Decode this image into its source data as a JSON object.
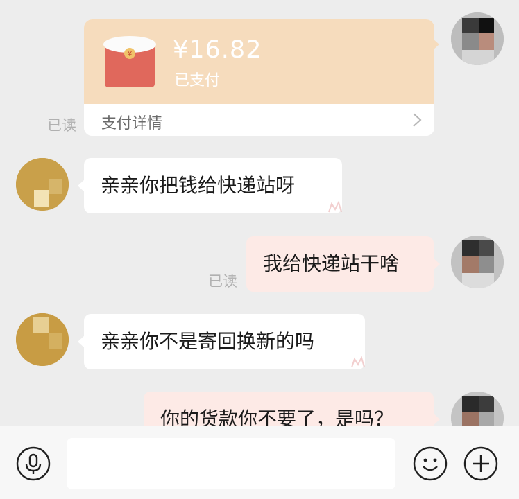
{
  "colors": {
    "background": "#ededed",
    "incoming_bubble": "#ffffff",
    "outgoing_bubble": "#fdeae6",
    "red_packet": "#f6dcbd",
    "envelope": "#e0685c"
  },
  "red_packet": {
    "amount": "¥16.82",
    "status": "已支付",
    "detail_label": "支付详情",
    "read_label": "已读",
    "envelope_icon": "red-envelope-icon",
    "chevron_icon": "chevron-right-icon"
  },
  "messages": [
    {
      "side": "left",
      "text": "亲亲你把钱给快递站呀"
    },
    {
      "side": "right",
      "text": "我给快递站干啥",
      "read_label": "已读"
    },
    {
      "side": "left",
      "text": "亲亲你不是寄回换新的吗"
    },
    {
      "side": "right",
      "text": "你的货款你不要了，是吗？"
    }
  ],
  "input_bar": {
    "voice_icon": "microphone-icon",
    "emoji_icon": "emoji-icon",
    "plus_icon": "plus-icon",
    "placeholder": ""
  }
}
